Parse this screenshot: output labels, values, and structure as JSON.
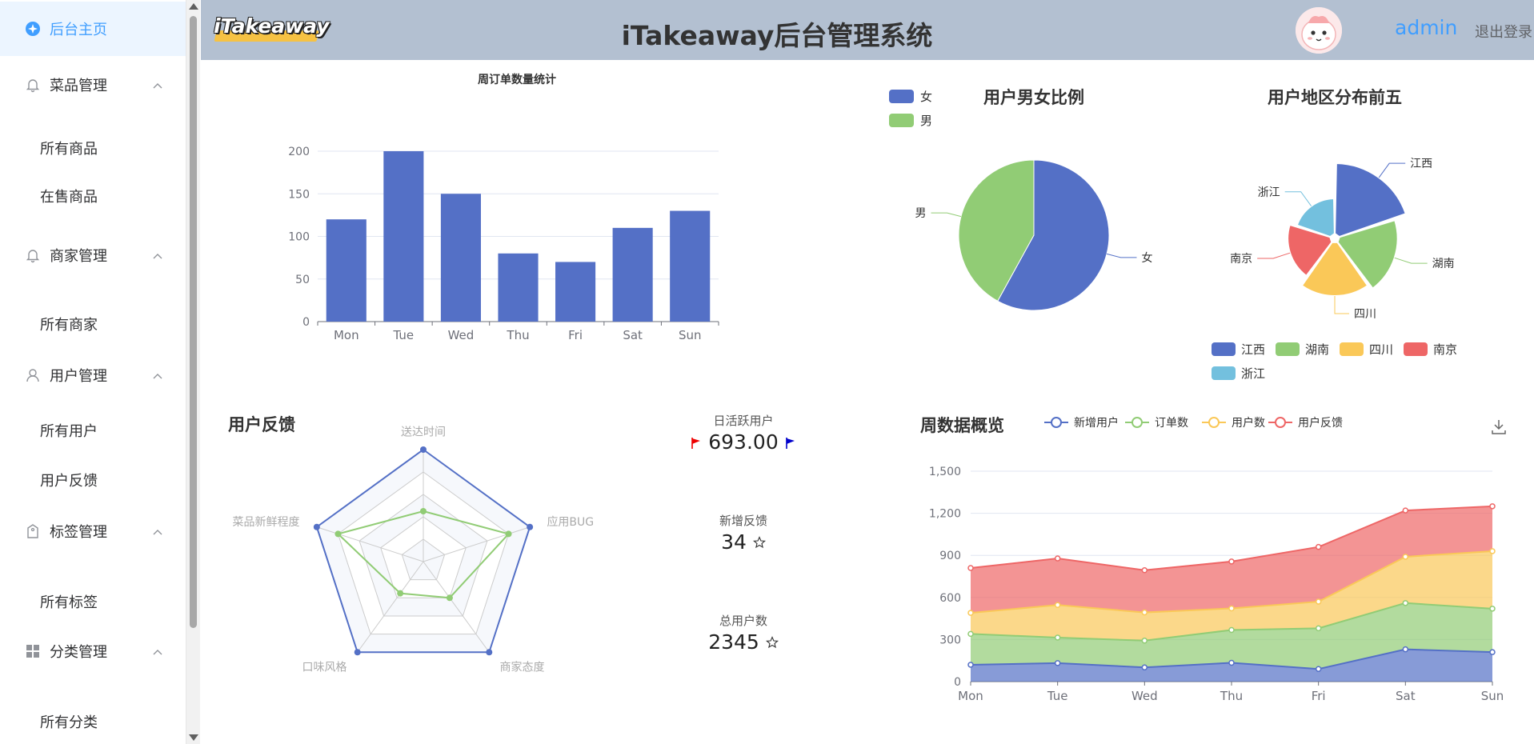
{
  "sidebar": {
    "home": "后台主页",
    "groups": [
      {
        "label": "菜品管理",
        "icon": "bell-icon",
        "items": [
          "所有商品",
          "在售商品"
        ]
      },
      {
        "label": "商家管理",
        "icon": "bell-icon",
        "items": [
          "所有商家"
        ]
      },
      {
        "label": "用户管理",
        "icon": "user-icon",
        "items": [
          "所有用户",
          "用户反馈"
        ]
      },
      {
        "label": "标签管理",
        "icon": "tag-icon",
        "items": [
          "所有标签"
        ]
      },
      {
        "label": "分类管理",
        "icon": "grid-icon",
        "items": [
          "所有分类"
        ]
      }
    ]
  },
  "header": {
    "logo": "iTakeaway",
    "title": "iTakeaway后台管理系统",
    "user": "admin",
    "logout": "退出登录"
  },
  "colors": {
    "blue": "#5470c6",
    "green": "#91cc75",
    "yellow": "#fac858",
    "red": "#ee6666",
    "cyan": "#73c0de",
    "accent": "#409eff",
    "header_bg": "#b3c0d1"
  },
  "stats": {
    "dau_label": "日活跃用户",
    "dau_value": "693.00",
    "feedback_label": "新增反馈",
    "feedback_value": "34",
    "total_label": "总用户数",
    "total_value": "2345"
  },
  "chart_data": [
    {
      "type": "bar",
      "title": "周订单数量统计",
      "categories": [
        "Mon",
        "Tue",
        "Wed",
        "Thu",
        "Fri",
        "Sat",
        "Sun"
      ],
      "values": [
        120,
        200,
        150,
        80,
        70,
        110,
        130
      ],
      "ylim": [
        0,
        200
      ],
      "yticks": [
        0,
        50,
        100,
        150,
        200
      ],
      "grid": true
    },
    {
      "type": "pie",
      "title": "用户男女比例",
      "legend_position": "top-left",
      "slices": [
        {
          "name": "女",
          "value": 58
        },
        {
          "name": "男",
          "value": 42
        }
      ]
    },
    {
      "type": "pie",
      "subtype": "rose",
      "title": "用户地区分布前五",
      "legend_position": "bottom",
      "slices": [
        {
          "name": "江西",
          "value": 40
        },
        {
          "name": "湖南",
          "value": 33
        },
        {
          "name": "四川",
          "value": 30
        },
        {
          "name": "南京",
          "value": 24
        },
        {
          "name": "浙江",
          "value": 20
        }
      ]
    },
    {
      "type": "radar",
      "title": "用户反馈",
      "indicators": [
        "送达时间",
        "应用BUG",
        "商家态度",
        "口味风格",
        "菜品新鲜程度"
      ],
      "max": 100,
      "series": [
        {
          "values": [
            100,
            100,
            100,
            100,
            100
          ]
        },
        {
          "values": [
            45,
            80,
            40,
            35,
            80
          ]
        }
      ]
    },
    {
      "type": "area",
      "stacked": true,
      "title": "周数据概览",
      "legend_position": "top",
      "x": [
        "Mon",
        "Tue",
        "Wed",
        "Thu",
        "Fri",
        "Sat",
        "Sun"
      ],
      "ylim": [
        0,
        1500
      ],
      "yticks": [
        "0",
        "300",
        "600",
        "900",
        "1,200",
        "1,500"
      ],
      "series": [
        {
          "name": "新增用户",
          "values": [
            120,
            132,
            101,
            134,
            90,
            230,
            210
          ]
        },
        {
          "name": "订单数",
          "values": [
            220,
            182,
            191,
            234,
            290,
            330,
            310
          ]
        },
        {
          "name": "用户数",
          "values": [
            150,
            232,
            201,
            154,
            190,
            330,
            410
          ]
        },
        {
          "name": "用户反馈",
          "values": [
            320,
            332,
            301,
            334,
            390,
            330,
            320
          ]
        }
      ]
    }
  ]
}
